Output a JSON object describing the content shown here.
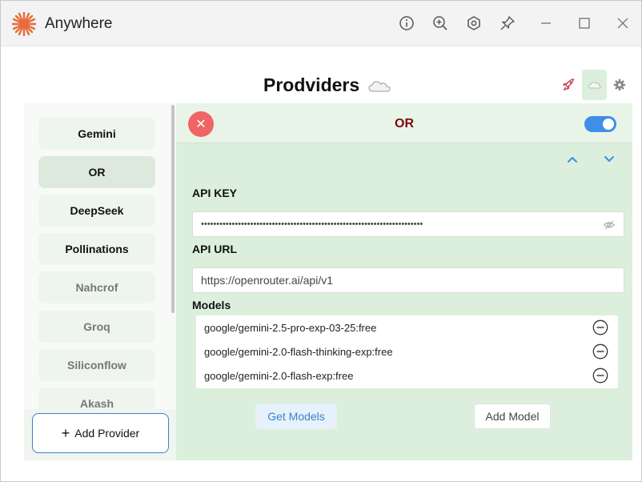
{
  "window": {
    "title": "Anywhere",
    "accent": "#e86a3a"
  },
  "titlebar_buttons": [
    "info-icon",
    "zoom-icon",
    "hexagon-settings-icon",
    "pin-icon",
    "minimize-icon",
    "maximize-icon",
    "close-icon"
  ],
  "header": {
    "title": "Prodviders",
    "icons": [
      "cloud-icon",
      "rocket-icon",
      "cloud-icon",
      "gear-icon"
    ]
  },
  "sidebar": {
    "items": [
      {
        "label": "Gemini",
        "state": "enabled"
      },
      {
        "label": "OR",
        "state": "active"
      },
      {
        "label": "DeepSeek",
        "state": "enabled"
      },
      {
        "label": "Pollinations",
        "state": "enabled"
      },
      {
        "label": "Nahcrof",
        "state": "disabled"
      },
      {
        "label": "Groq",
        "state": "disabled"
      },
      {
        "label": "Siliconflow",
        "state": "disabled"
      },
      {
        "label": "Akash",
        "state": "disabled"
      }
    ],
    "add_label": "Add Provider"
  },
  "panel": {
    "name": "OR",
    "enabled": true,
    "api_key_label": "API KEY",
    "api_key_masked": "••••••••••••••••••••••••••••••••••••••••••••••••••••••••••••••••••••••••",
    "api_url_label": "API URL",
    "api_url": "https://openrouter.ai/api/v1",
    "models_label": "Models",
    "models": [
      "google/gemini-2.5-pro-exp-03-25:free",
      "google/gemini-2.0-flash-thinking-exp:free",
      "google/gemini-2.0-flash-exp:free"
    ],
    "get_models_label": "Get Models",
    "add_model_label": "Add Model"
  },
  "colors": {
    "toggle": "#3f8fe8",
    "close": "#f06466",
    "panel_bg": "#dcefdc",
    "provider_name": "#7a0b0b"
  }
}
